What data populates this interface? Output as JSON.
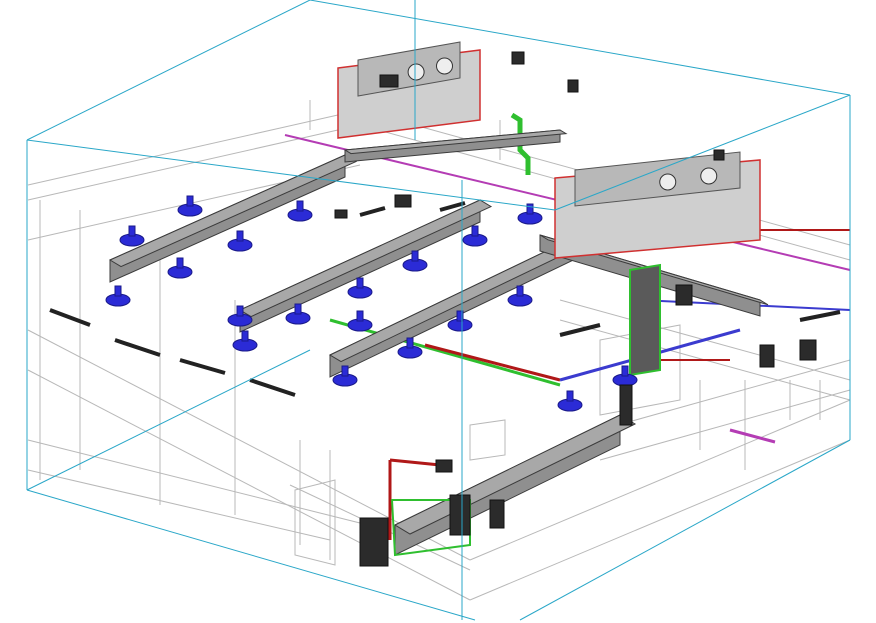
{
  "view": {
    "background": "#ffffff",
    "colors": {
      "section_box": "#2aa7c8",
      "building_lines": "#b8b8b8",
      "duct_fill": "#8f8f8f",
      "duct_top": "#a8a8a8",
      "duct_edge": "#3b3b3b",
      "diffuser": "#2b2bd6",
      "diffuser_dark": "#1a1a8a",
      "hydronic_green": "#2fbf2f",
      "pipe_red": "#b01818",
      "pipe_magenta": "#b43cb4",
      "pipe_blue": "#3b3bcf",
      "ahu_body": "#cfcfcf",
      "ahu_outline": "#d03030",
      "equipment_dark": "#2b2b2b"
    },
    "components": {
      "section_box_icon": "section-box",
      "diffuser_icon": "air-diffuser",
      "ahu_icon": "rooftop-unit"
    }
  }
}
